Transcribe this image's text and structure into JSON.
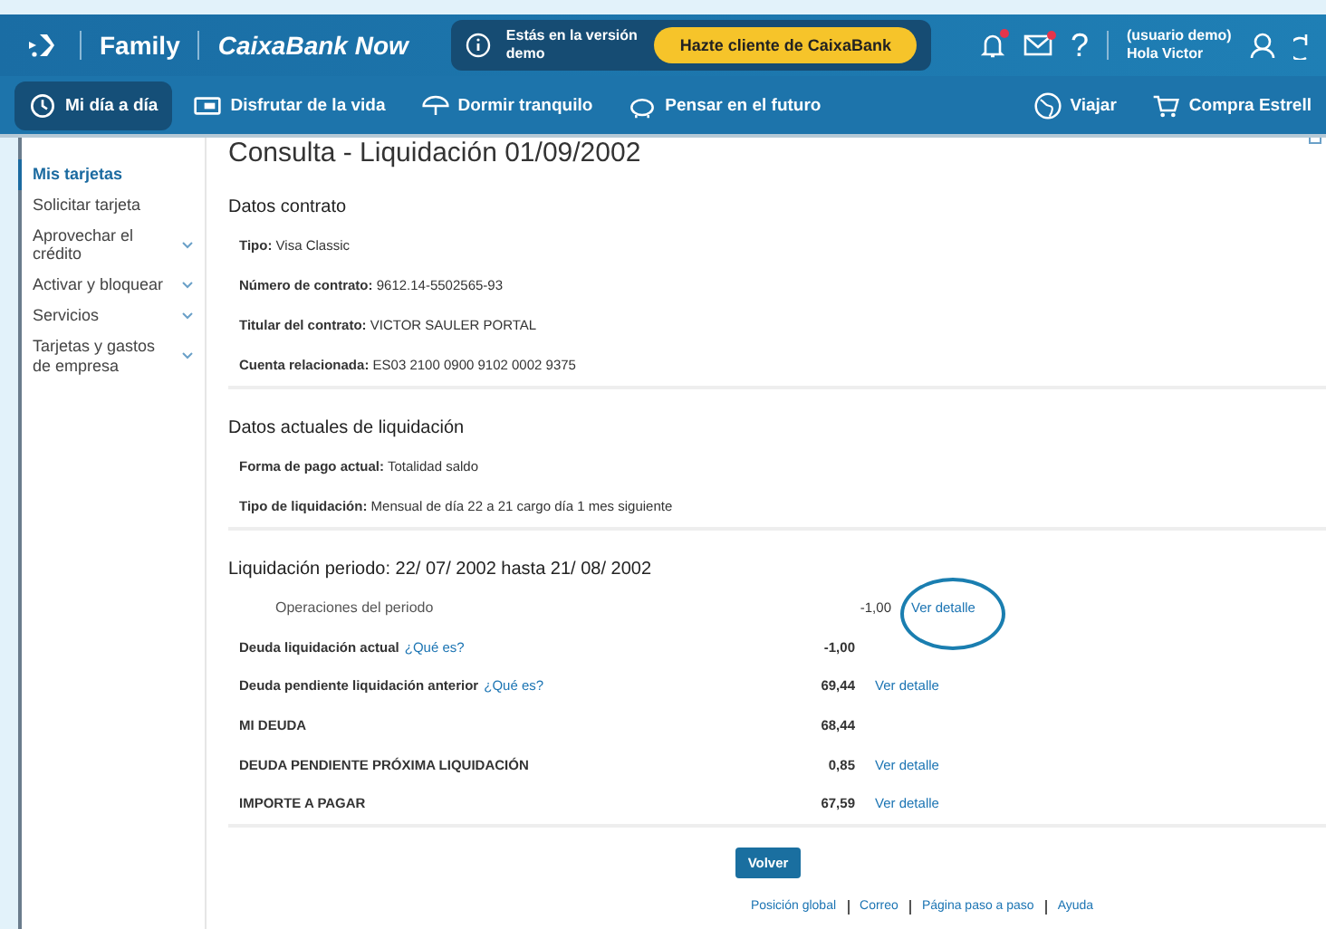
{
  "header": {
    "brand": "Family",
    "product": "CaixaBank Now",
    "demo_notice": "Estás en la versión demo",
    "cta": "Hazte cliente de CaixaBank",
    "help": "?",
    "user": "(usuario demo) Hola Victor",
    "notifications_unread": true,
    "messages_unread": true
  },
  "nav": [
    {
      "label": "Mi día a día",
      "selected": true
    },
    {
      "label": "Disfrutar de la vida",
      "selected": false
    },
    {
      "label": "Dormir tranquilo",
      "selected": false
    },
    {
      "label": "Pensar en el futuro",
      "selected": false
    },
    {
      "label": "Viajar",
      "selected": false
    },
    {
      "label": "Compra Estrell",
      "selected": false
    }
  ],
  "sidebar": [
    {
      "label": "Mis tarjetas",
      "selected": true,
      "expandable": false
    },
    {
      "label": "Solicitar tarjeta",
      "selected": false,
      "expandable": false
    },
    {
      "label": "Aprovechar el crédito",
      "selected": false,
      "expandable": true
    },
    {
      "label": "Activar y bloquear",
      "selected": false,
      "expandable": true
    },
    {
      "label": "Servicios",
      "selected": false,
      "expandable": true
    },
    {
      "label": "Tarjetas y gastos de empresa",
      "selected": false,
      "expandable": true
    }
  ],
  "title": "Consulta - Liquidación 01/09/2002",
  "sections": [
    {
      "heading": "Datos contrato",
      "fields": [
        {
          "text": "**Tipo:** Visa Classic"
        },
        {
          "text": "**Número de contrato:** 9612.14-5502565-93"
        },
        {
          "text": "**Titular del contrato:** VICTOR SAULER PORTAL"
        },
        {
          "text": "**Cuenta relacionada:** ES03 2100 0900 9102 0002 9375"
        }
      ]
    },
    {
      "heading": "Datos actuales de liquidación",
      "fields": [
        {
          "text": "**Forma de pago actual:** Totalidad saldo"
        },
        {
          "text": "**Tipo de liquidación:** Mensual de día 22 a 21 cargo día 1 mes siguiente"
        }
      ]
    }
  ],
  "period": {
    "heading": "Liquidación periodo:  22/ 07/ 2002 hasta 21/ 08/ 2002",
    "rows": [
      {
        "kind": "indent",
        "label": "Operaciones del periodo",
        "amount": "-1,00",
        "detail": "Ver detalle",
        "circled": true
      },
      {
        "kind": "bold",
        "label": "Deuda liquidación actual",
        "help": "¿Qué es?",
        "amount": "-1,00",
        "circled": false
      },
      {
        "kind": "bold",
        "label": "Deuda pendiente liquidación anterior",
        "help": "¿Qué es?",
        "amount": "69,44",
        "detail": "Ver detalle",
        "circled": false
      },
      {
        "kind": "bold",
        "label": "MI DEUDA",
        "amount": "68,44",
        "circled": false
      },
      {
        "kind": "bold",
        "label": "DEUDA PENDIENTE PRÓXIMA LIQUIDACIÓN",
        "amount": "0,85",
        "detail": "Ver detalle",
        "circled": false
      },
      {
        "kind": "bold",
        "label": "IMPORTE A PAGAR",
        "amount": "67,59",
        "detail": "Ver detalle",
        "circled": false
      }
    ]
  },
  "back_button": "Volver",
  "footer_links": [
    "Posición global",
    "Correo",
    "Página paso a paso",
    "Ayuda"
  ]
}
